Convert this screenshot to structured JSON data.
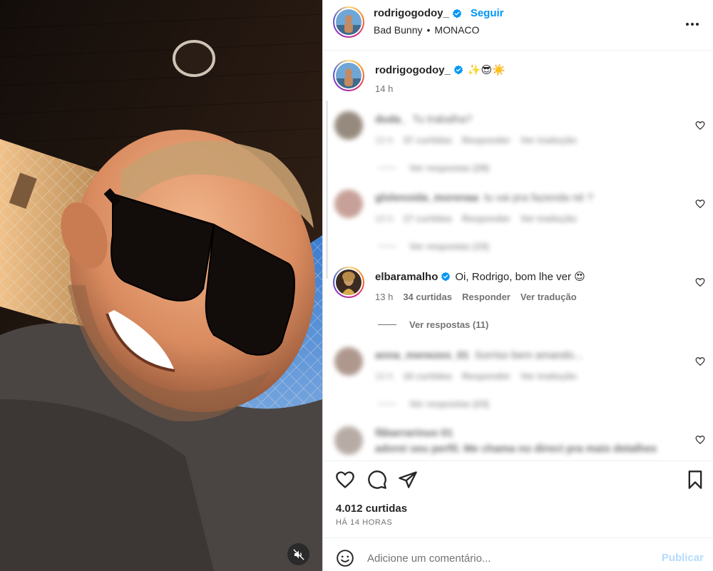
{
  "post": {
    "author": "rodrigogodoy_",
    "follow_label": "Seguir",
    "audio": "Bad Bunny",
    "separator": "•",
    "location": "MONACO",
    "verified_icon": "verified-badge-icon",
    "more_icon": "more-options-icon"
  },
  "caption": {
    "username": "rodrigogodoy_",
    "text": "✨😎☀️",
    "time": "14 h"
  },
  "comments": [
    {
      "username": "duda_",
      "text": "Tu trabalha?",
      "time": "10 h",
      "likes": "37 curtidas",
      "reply_label": "Responder",
      "translate_label": "Ver tradução",
      "replies_label": "Ver respostas (28)",
      "blurred": true
    },
    {
      "username": "glslenoida_morenaa",
      "text": "tu vai pra fazenda né ?",
      "time": "10 h",
      "likes": "17 curtidas",
      "reply_label": "Responder",
      "translate_label": "Ver tradução",
      "replies_label": "Ver respostas (15)",
      "blurred": true
    },
    {
      "username": "elbaramalho",
      "text": "Oi, Rodrigo, bom lhe ver 😍",
      "time": "13 h",
      "likes": "34 curtidas",
      "reply_label": "Responder",
      "translate_label": "Ver tradução",
      "replies_label": "Ver respostas (11)",
      "blurred": false
    },
    {
      "username": "anna_menezes_01",
      "text": "Sorriso bem amando...",
      "time": "10 h",
      "likes": "16 curtidas",
      "reply_label": "Responder",
      "translate_label": "Ver tradução",
      "replies_label": "Ver respostas (23)",
      "blurred": true
    },
    {
      "username": "fãbarrarinuo 01",
      "text": "adorei seu perfil. Me chama no direct pra mais detalhes",
      "blurred": true
    }
  ],
  "actions": {
    "like_icon": "heart-icon",
    "comment_icon": "comment-bubble-icon",
    "share_icon": "paper-plane-icon",
    "save_icon": "bookmark-icon",
    "likes_count": "4.012 curtidas",
    "time_ago": "HÁ 14 HORAS"
  },
  "add_comment": {
    "emoji_icon": "emoji-smiley-icon",
    "placeholder": "Adicione um comentário...",
    "publish_label": "Publicar"
  },
  "media": {
    "mute_icon": "muted-speaker-icon"
  },
  "colors": {
    "accent": "#0095f6",
    "publish_disabled": "#b3dbff",
    "text": "#262626",
    "secondary": "#737373"
  }
}
